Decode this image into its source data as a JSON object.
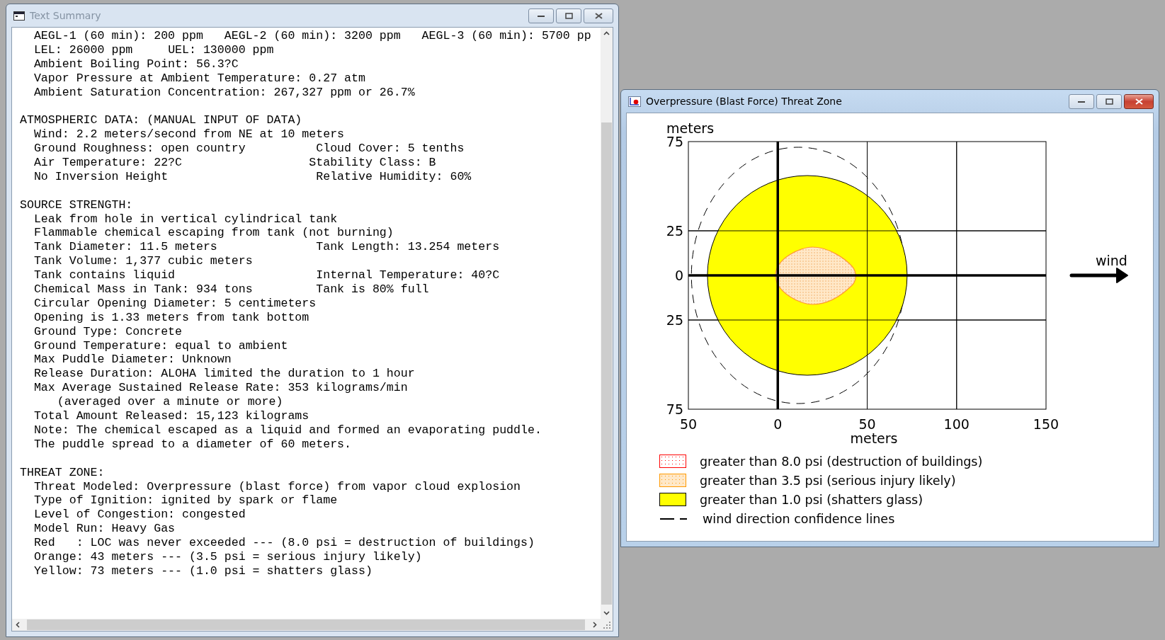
{
  "text_window": {
    "title": "Text Summary",
    "active": false,
    "sections": [
      {
        "lines": [
          {
            "kind": "line",
            "text": "AEGL-1 (60 min): 200 ppm   AEGL-2 (60 min): 3200 ppm   AEGL-3 (60 min): 5700 pp"
          },
          {
            "kind": "line",
            "text": "LEL: 26000 ppm     UEL: 130000 ppm"
          },
          {
            "kind": "line",
            "text": "Ambient Boiling Point: 56.3?C"
          },
          {
            "kind": "line",
            "text": "Vapor Pressure at Ambient Temperature: 0.27 atm"
          },
          {
            "kind": "line",
            "text": "Ambient Saturation Concentration: 267,327 ppm or 26.7%"
          }
        ]
      },
      {
        "heading": "ATMOSPHERIC DATA: (MANUAL INPUT OF DATA)",
        "lines": [
          {
            "kind": "line",
            "text": "Wind: 2.2 meters/second from NE at 10 meters"
          },
          {
            "kind": "line",
            "text": "Ground Roughness: open country          Cloud Cover: 5 tenths"
          },
          {
            "kind": "line",
            "text": "Air Temperature: 22?C                  Stability Class: B"
          },
          {
            "kind": "line",
            "text": "No Inversion Height                     Relative Humidity: 60%"
          }
        ]
      },
      {
        "heading": "SOURCE STRENGTH:",
        "lines": [
          {
            "kind": "line",
            "text": "Leak from hole in vertical cylindrical tank"
          },
          {
            "kind": "line",
            "text": "Flammable chemical escaping from tank (not burning)"
          },
          {
            "kind": "line",
            "text": "Tank Diameter: 11.5 meters              Tank Length: 13.254 meters"
          },
          {
            "kind": "line",
            "text": "Tank Volume: 1,377 cubic meters"
          },
          {
            "kind": "line",
            "text": "Tank contains liquid                    Internal Temperature: 40?C"
          },
          {
            "kind": "line",
            "text": "Chemical Mass in Tank: 934 tons         Tank is 80% full"
          },
          {
            "kind": "line",
            "text": "Circular Opening Diameter: 5 centimeters"
          },
          {
            "kind": "line",
            "text": "Opening is 1.33 meters from tank bottom"
          },
          {
            "kind": "line",
            "text": "Ground Type: Concrete"
          },
          {
            "kind": "line",
            "text": "Ground Temperature: equal to ambient"
          },
          {
            "kind": "line",
            "text": "Max Puddle Diameter: Unknown"
          },
          {
            "kind": "line",
            "text": "Release Duration: ALOHA limited the duration to 1 hour"
          },
          {
            "kind": "line",
            "text": "Max Average Sustained Release Rate: 353 kilograms/min"
          },
          {
            "kind": "continuation",
            "text": "(averaged over a minute or more)"
          },
          {
            "kind": "line",
            "text": "Total Amount Released: 15,123 kilograms"
          },
          {
            "kind": "line",
            "text": "Note: The chemical escaped as a liquid and formed an evaporating puddle."
          },
          {
            "kind": "line",
            "text": "The puddle spread to a diameter of 60 meters."
          }
        ]
      },
      {
        "heading": "THREAT ZONE:",
        "lines": [
          {
            "kind": "line",
            "text": "Threat Modeled: Overpressure (blast force) from vapor cloud explosion"
          },
          {
            "kind": "line",
            "text": "Type of Ignition: ignited by spark or flame"
          },
          {
            "kind": "line",
            "text": "Level of Congestion: congested"
          },
          {
            "kind": "line",
            "text": "Model Run: Heavy Gas"
          },
          {
            "kind": "line",
            "text": "Red   : LOC was never exceeded --- (8.0 psi = destruction of buildings)"
          },
          {
            "kind": "line",
            "text": "Orange: 43 meters --- (3.5 psi = serious injury likely)"
          },
          {
            "kind": "line",
            "text": "Yellow: 73 meters --- (1.0 psi = shatters glass)"
          }
        ]
      }
    ]
  },
  "plot_window": {
    "title": "Overpressure (Blast Force) Threat Zone",
    "active": true,
    "plot": {
      "y_label": "meters",
      "y_ticks": [
        "75",
        "25",
        "0",
        "25",
        "75"
      ],
      "x_ticks": [
        "50",
        "0",
        "50",
        "100",
        "150"
      ],
      "x_label": "meters",
      "wind_label": "wind"
    },
    "legend": [
      {
        "kind": "dotted",
        "color": "#ff0000",
        "label": "greater than 8.0 psi (destruction of buildings)"
      },
      {
        "kind": "dotted",
        "color": "#ff9900",
        "label": "greater than 3.5 psi (serious injury likely)"
      },
      {
        "kind": "solid",
        "color": "#ffff00",
        "label": "greater than 1.0 psi (shatters glass)"
      },
      {
        "kind": "dashed",
        "color": "#000000",
        "label": "wind direction confidence lines"
      }
    ]
  }
}
